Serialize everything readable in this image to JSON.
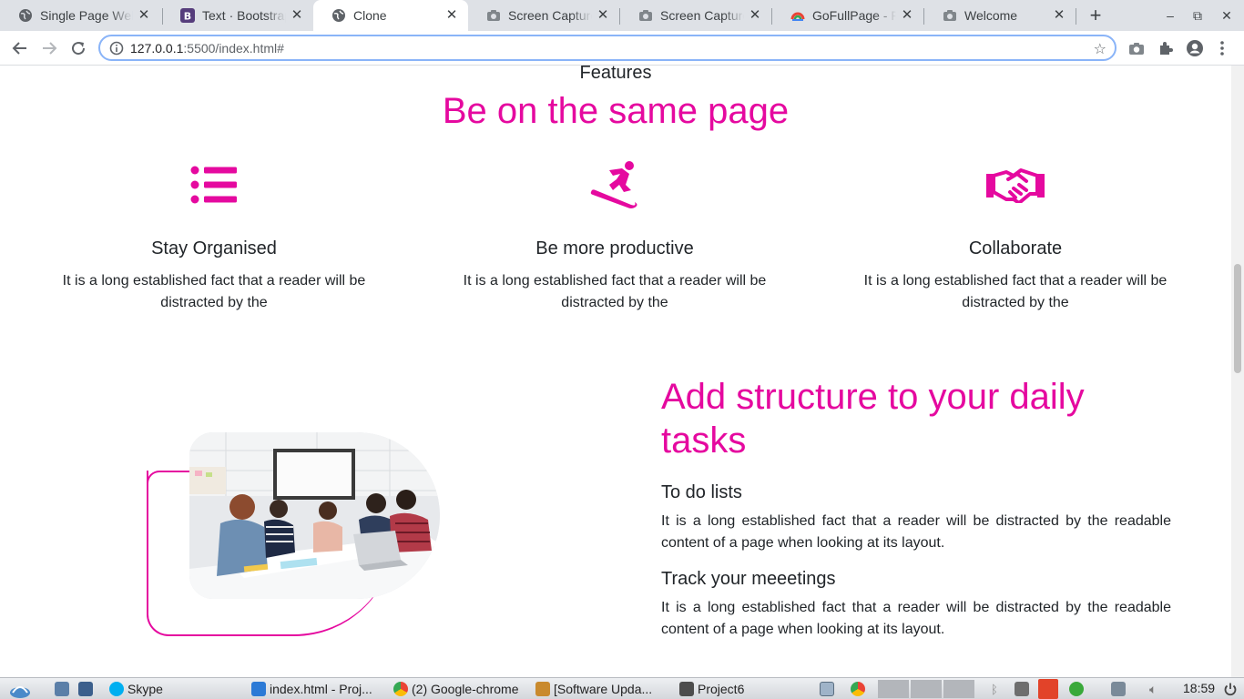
{
  "browser": {
    "tabs": [
      {
        "title": "Single Page Web",
        "favicon": "globe-icon",
        "active": false
      },
      {
        "title": "Text · Bootstrap",
        "favicon": "bootstrap-icon",
        "active": false
      },
      {
        "title": "Clone",
        "favicon": "globe-icon",
        "active": true
      },
      {
        "title": "Screen Capture",
        "favicon": "camera-icon",
        "active": false
      },
      {
        "title": "Screen Capture",
        "favicon": "camera-icon",
        "active": false
      },
      {
        "title": "GoFullPage - Fu",
        "favicon": "gofullpage-icon",
        "active": false
      },
      {
        "title": "Welcome",
        "favicon": "camera-icon",
        "active": false
      }
    ],
    "close_glyph": "✕",
    "new_tab_glyph": "+",
    "window_controls": {
      "minimize": "–",
      "restore": "⧉",
      "close": "✕"
    },
    "url_host": "127.0.0.1",
    "url_rest": ":5500/index.html#"
  },
  "page": {
    "features_label": "Features",
    "heading": "Be on the same page",
    "accent_color": "#e5099f",
    "features": [
      {
        "icon": "list-icon",
        "title": "Stay Organised",
        "text": "It is a long established fact that a reader will be distracted by the"
      },
      {
        "icon": "snowboarder-icon",
        "title": "Be more productive",
        "text": "It is a long established fact that a reader will be distracted by the"
      },
      {
        "icon": "handshake-icon",
        "title": "Collaborate",
        "text": "It is a long established fact that a reader will be distracted by the"
      }
    ],
    "structure": {
      "title": "Add structure to your daily tasks",
      "items": [
        {
          "title": "To do lists",
          "text": "It is a long established fact that a reader will be distracted by the readable content of a page when looking at its layout."
        },
        {
          "title": "Track your meeetings",
          "text": "It is a long established fact that a reader will be distracted by the readable content of a page when looking at its layout."
        }
      ]
    }
  },
  "taskbar": {
    "items": [
      {
        "label": "Skype",
        "icon": "skype-icon"
      },
      {
        "label": "index.html - Proj...",
        "icon": "vscode-icon"
      },
      {
        "label": "(2) Google-chrome",
        "icon": "chrome-icon"
      },
      {
        "label": "[Software Upda...",
        "icon": "package-icon"
      },
      {
        "label": "Project6",
        "icon": "folder-icon"
      }
    ],
    "clock": "18:59"
  }
}
